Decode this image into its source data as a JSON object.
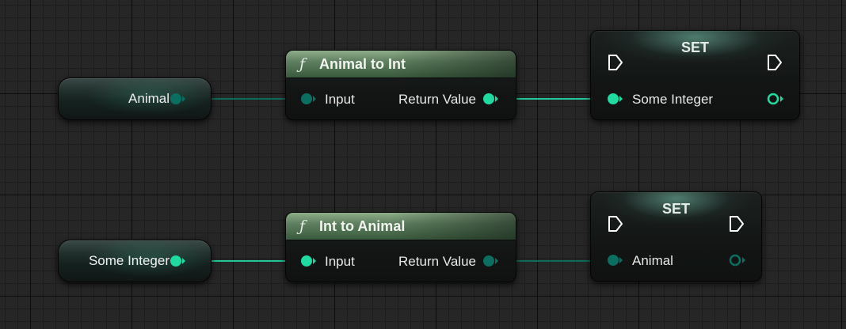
{
  "nodes": {
    "var_animal": {
      "label": "Animal"
    },
    "animal_to_int": {
      "title": "Animal to Int",
      "icon": "function-icon",
      "input_label": "Input",
      "output_label": "Return Value"
    },
    "set_integer": {
      "title": "SET",
      "pin_label": "Some Integer"
    },
    "var_some_integer": {
      "label": "Some Integer"
    },
    "int_to_animal": {
      "title": "Int to Animal",
      "icon": "function-icon",
      "input_label": "Input",
      "output_label": "Return Value"
    },
    "set_animal": {
      "title": "SET",
      "pin_label": "Animal"
    }
  },
  "func_icon_glyph": "ƒ",
  "colors": {
    "int_pin": "#1fdba2",
    "enum_pin": "#0a6e60",
    "func_header": "#5f8060",
    "exec_pin": "#ffffff",
    "wire_int": "#1fc79a",
    "wire_enum": "#0d6b5c"
  }
}
